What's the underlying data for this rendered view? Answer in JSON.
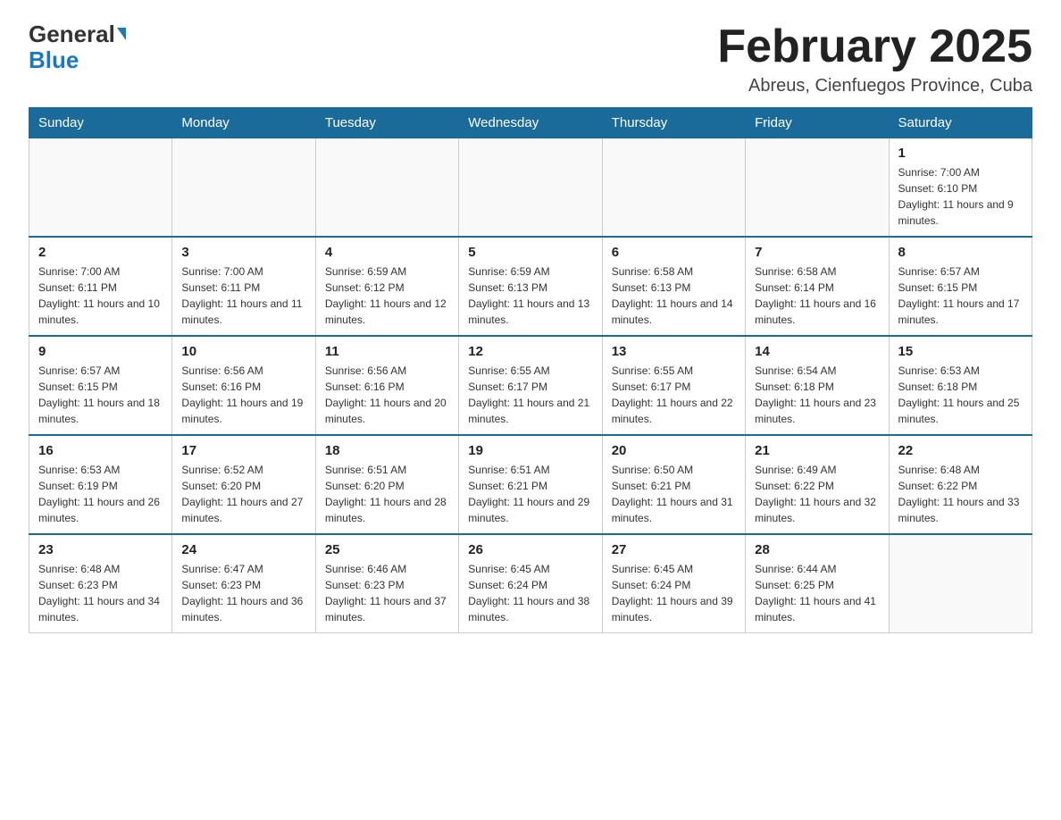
{
  "logo": {
    "general": "General",
    "blue": "Blue"
  },
  "title": "February 2025",
  "subtitle": "Abreus, Cienfuegos Province, Cuba",
  "days_of_week": [
    "Sunday",
    "Monday",
    "Tuesday",
    "Wednesday",
    "Thursday",
    "Friday",
    "Saturday"
  ],
  "weeks": [
    [
      {
        "day": "",
        "info": ""
      },
      {
        "day": "",
        "info": ""
      },
      {
        "day": "",
        "info": ""
      },
      {
        "day": "",
        "info": ""
      },
      {
        "day": "",
        "info": ""
      },
      {
        "day": "",
        "info": ""
      },
      {
        "day": "1",
        "info": "Sunrise: 7:00 AM\nSunset: 6:10 PM\nDaylight: 11 hours and 9 minutes."
      }
    ],
    [
      {
        "day": "2",
        "info": "Sunrise: 7:00 AM\nSunset: 6:11 PM\nDaylight: 11 hours and 10 minutes."
      },
      {
        "day": "3",
        "info": "Sunrise: 7:00 AM\nSunset: 6:11 PM\nDaylight: 11 hours and 11 minutes."
      },
      {
        "day": "4",
        "info": "Sunrise: 6:59 AM\nSunset: 6:12 PM\nDaylight: 11 hours and 12 minutes."
      },
      {
        "day": "5",
        "info": "Sunrise: 6:59 AM\nSunset: 6:13 PM\nDaylight: 11 hours and 13 minutes."
      },
      {
        "day": "6",
        "info": "Sunrise: 6:58 AM\nSunset: 6:13 PM\nDaylight: 11 hours and 14 minutes."
      },
      {
        "day": "7",
        "info": "Sunrise: 6:58 AM\nSunset: 6:14 PM\nDaylight: 11 hours and 16 minutes."
      },
      {
        "day": "8",
        "info": "Sunrise: 6:57 AM\nSunset: 6:15 PM\nDaylight: 11 hours and 17 minutes."
      }
    ],
    [
      {
        "day": "9",
        "info": "Sunrise: 6:57 AM\nSunset: 6:15 PM\nDaylight: 11 hours and 18 minutes."
      },
      {
        "day": "10",
        "info": "Sunrise: 6:56 AM\nSunset: 6:16 PM\nDaylight: 11 hours and 19 minutes."
      },
      {
        "day": "11",
        "info": "Sunrise: 6:56 AM\nSunset: 6:16 PM\nDaylight: 11 hours and 20 minutes."
      },
      {
        "day": "12",
        "info": "Sunrise: 6:55 AM\nSunset: 6:17 PM\nDaylight: 11 hours and 21 minutes."
      },
      {
        "day": "13",
        "info": "Sunrise: 6:55 AM\nSunset: 6:17 PM\nDaylight: 11 hours and 22 minutes."
      },
      {
        "day": "14",
        "info": "Sunrise: 6:54 AM\nSunset: 6:18 PM\nDaylight: 11 hours and 23 minutes."
      },
      {
        "day": "15",
        "info": "Sunrise: 6:53 AM\nSunset: 6:18 PM\nDaylight: 11 hours and 25 minutes."
      }
    ],
    [
      {
        "day": "16",
        "info": "Sunrise: 6:53 AM\nSunset: 6:19 PM\nDaylight: 11 hours and 26 minutes."
      },
      {
        "day": "17",
        "info": "Sunrise: 6:52 AM\nSunset: 6:20 PM\nDaylight: 11 hours and 27 minutes."
      },
      {
        "day": "18",
        "info": "Sunrise: 6:51 AM\nSunset: 6:20 PM\nDaylight: 11 hours and 28 minutes."
      },
      {
        "day": "19",
        "info": "Sunrise: 6:51 AM\nSunset: 6:21 PM\nDaylight: 11 hours and 29 minutes."
      },
      {
        "day": "20",
        "info": "Sunrise: 6:50 AM\nSunset: 6:21 PM\nDaylight: 11 hours and 31 minutes."
      },
      {
        "day": "21",
        "info": "Sunrise: 6:49 AM\nSunset: 6:22 PM\nDaylight: 11 hours and 32 minutes."
      },
      {
        "day": "22",
        "info": "Sunrise: 6:48 AM\nSunset: 6:22 PM\nDaylight: 11 hours and 33 minutes."
      }
    ],
    [
      {
        "day": "23",
        "info": "Sunrise: 6:48 AM\nSunset: 6:23 PM\nDaylight: 11 hours and 34 minutes."
      },
      {
        "day": "24",
        "info": "Sunrise: 6:47 AM\nSunset: 6:23 PM\nDaylight: 11 hours and 36 minutes."
      },
      {
        "day": "25",
        "info": "Sunrise: 6:46 AM\nSunset: 6:23 PM\nDaylight: 11 hours and 37 minutes."
      },
      {
        "day": "26",
        "info": "Sunrise: 6:45 AM\nSunset: 6:24 PM\nDaylight: 11 hours and 38 minutes."
      },
      {
        "day": "27",
        "info": "Sunrise: 6:45 AM\nSunset: 6:24 PM\nDaylight: 11 hours and 39 minutes."
      },
      {
        "day": "28",
        "info": "Sunrise: 6:44 AM\nSunset: 6:25 PM\nDaylight: 11 hours and 41 minutes."
      },
      {
        "day": "",
        "info": ""
      }
    ]
  ]
}
